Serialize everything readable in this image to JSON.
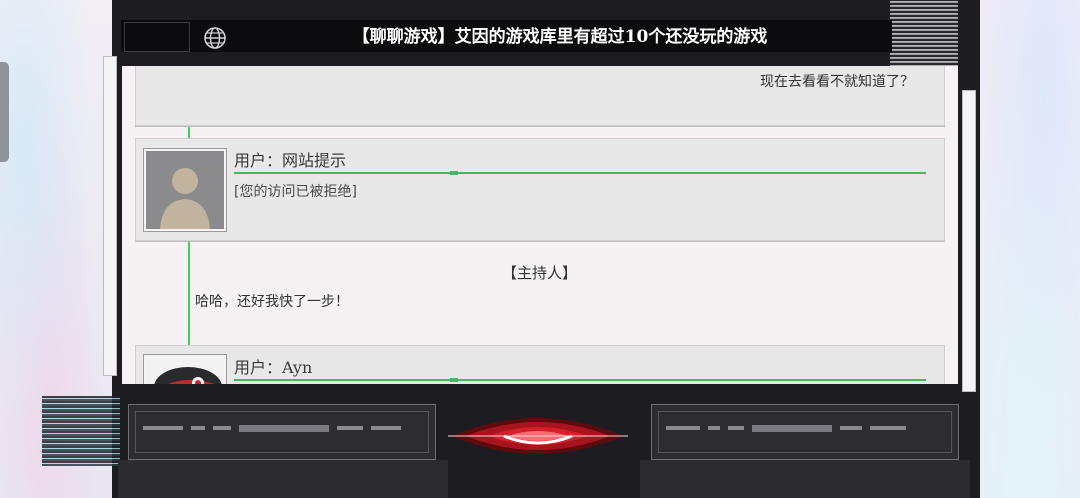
{
  "header": {
    "title": "【聊聊游戏】艾因的游戏库里有超过10个还没玩的游戏",
    "globe_icon": "globe-icon"
  },
  "posts": [
    {
      "type": "truncated-card",
      "text": "现在去看看不就知道了？"
    },
    {
      "type": "user-card",
      "user_label": "用户：网站提示",
      "message": "[您的访问已被拒绝]",
      "avatar_icon": "default-user-avatar"
    },
    {
      "type": "host",
      "name": "【主持人】",
      "message": "哈哈，还好我快了一步！"
    },
    {
      "type": "user-card",
      "user_label": "用户：Ayn",
      "message": "",
      "avatar_icon": "ayn-avatar"
    }
  ],
  "footer": {
    "left_button_icon": "glitched-left-button",
    "right_button_icon": "glitched-right-button",
    "center_icon": "red-eye-icon"
  },
  "colors": {
    "accent_green": "#45b861",
    "guide_green": "#39d34f",
    "eye_red": "#d11f2b",
    "frame_dark": "#1d1c20"
  }
}
